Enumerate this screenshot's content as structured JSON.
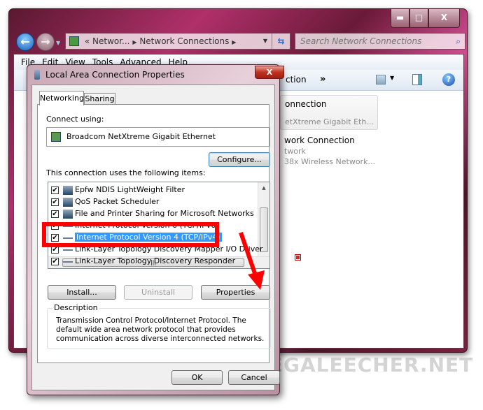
{
  "explorer": {
    "caption_buttons": {
      "minimize": "▬",
      "maximize": "□",
      "close": "X"
    },
    "breadcrumb": [
      "Networ...",
      "Network Connections"
    ],
    "breadcrumb_prefix": "«",
    "search_placeholder": "Search Network Connections",
    "menu": [
      "File",
      "Edit",
      "View",
      "Tools",
      "Advanced",
      "Help"
    ],
    "toolbar_partial": "ction",
    "toolbar_more": "»",
    "connections": [
      {
        "name": "onnection",
        "device": "etXtreme Gigabit Eth..."
      },
      {
        "name": "work Connection",
        "status": "twork",
        "device": "38x Wireless Network..."
      }
    ]
  },
  "dialog": {
    "title": "Local Area Connection Properties",
    "close": "X",
    "tabs": [
      "Networking",
      "Sharing"
    ],
    "connect_using_label": "Connect using:",
    "adapter": "Broadcom NetXtreme Gigabit Ethernet",
    "configure": "Configure...",
    "items_label": "This connection uses the following items:",
    "items": [
      {
        "label": "Epfw NDIS LightWeight Filter",
        "checked": true,
        "icon": "network-client-icon"
      },
      {
        "label": "QoS Packet Scheduler",
        "checked": true,
        "icon": "network-client-icon"
      },
      {
        "label": "File and Printer Sharing for Microsoft Networks",
        "checked": true,
        "icon": "network-client-icon"
      },
      {
        "label": "Internet Protocol Version 6 (TCP/IPv6)",
        "checked": true,
        "icon": "protocol-icon"
      },
      {
        "label": "Internet Protocol Version 4 (TCP/IPv4)",
        "checked": true,
        "icon": "protocol-icon",
        "selected": true
      },
      {
        "label": "Link-Layer Topology Discovery Mapper I/O Driver",
        "checked": true,
        "icon": "protocol-icon"
      },
      {
        "label": "Link-Layer Topology Discovery Responder",
        "checked": true,
        "icon": "protocol-icon"
      }
    ],
    "install": "Install...",
    "uninstall": "Uninstall",
    "properties": "Properties",
    "description_label": "Description",
    "description": "Transmission Control Protocol/Internet Protocol. The default wide area network protocol that provides communication across diverse interconnected networks.",
    "ok": "OK",
    "cancel": "Cancel"
  },
  "annotation": {
    "highlight_color": "#ff0000"
  },
  "watermark": "MEGALEECHER.NET"
}
